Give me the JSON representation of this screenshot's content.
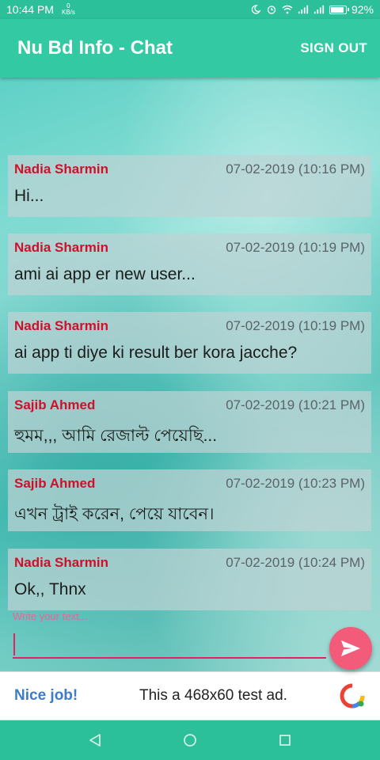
{
  "status_bar": {
    "time": "10:44 PM",
    "net_speed_value": "0",
    "net_speed_unit": "KB/s",
    "battery": "92%",
    "battery_level": 0.92
  },
  "app_bar": {
    "title": "Nu Bd Info - Chat",
    "sign_out": "SIGN OUT"
  },
  "messages": [
    {
      "sender": "Nadia Sharmin",
      "time": "07-02-2019 (10:16 PM)",
      "text": "Hi..."
    },
    {
      "sender": "Nadia Sharmin",
      "time": "07-02-2019 (10:19 PM)",
      "text": "ami ai app er new user..."
    },
    {
      "sender": "Nadia Sharmin",
      "time": "07-02-2019 (10:19 PM)",
      "text": "ai app ti diye ki result ber kora jacche?"
    },
    {
      "sender": "Sajib Ahmed",
      "time": "07-02-2019 (10:21 PM)",
      "text": "হুমম,,, আমি রেজাল্ট পেয়েছি..."
    },
    {
      "sender": "Sajib Ahmed",
      "time": "07-02-2019 (10:23 PM)",
      "text": "এখন ট্রাই করেন, পেয়ে যাবেন।"
    },
    {
      "sender": "Nadia Sharmin",
      "time": "07-02-2019 (10:24 PM)",
      "text": "Ok,, Thnx"
    }
  ],
  "composer": {
    "label": "Write your text...",
    "value": ""
  },
  "ad": {
    "nice": "Nice job!",
    "text": "This a 468x60 test ad."
  },
  "colors": {
    "primary": "#33c9a3",
    "sender": "#d0102a",
    "accent": "#e91e63"
  },
  "icons": {
    "send": "send-icon",
    "nav_back": "back-triangle-icon",
    "nav_home": "home-circle-icon",
    "nav_recents": "recents-square-icon"
  }
}
